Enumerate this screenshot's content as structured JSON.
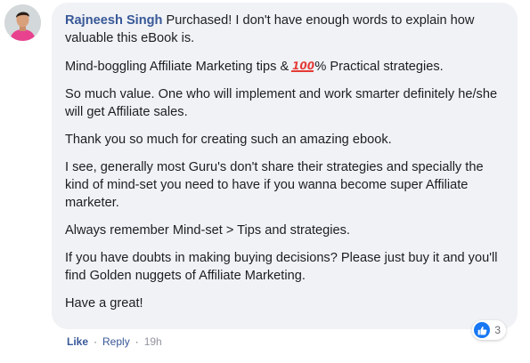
{
  "comment": {
    "author": "Rajneesh Singh",
    "paragraphs": [
      {
        "text": "Purchased! I don't have enough words to explain how valuable this eBook is."
      },
      {
        "before": "Mind-boggling Affiliate Marketing tips & ",
        "emoji": "100",
        "after": "% Practical strategies."
      },
      {
        "text": "So much value. One who will implement and work smarter definitely he/she will get Affiliate sales."
      },
      {
        "text": "Thank you so much for creating such an amazing ebook."
      },
      {
        "text": "I see, generally most Guru's don't share their strategies and specially the kind of mind-set you need to have if you wanna become super Affiliate marketer."
      },
      {
        "text": "Always remember Mind-set > Tips and strategies."
      },
      {
        "text": "If you have doubts in making buying decisions? Please just buy it and you'll find Golden nuggets of Affiliate Marketing."
      },
      {
        "text": "Have a great!"
      }
    ],
    "reactions": {
      "icon": "like-thumbs-up-icon",
      "count": "3",
      "color": "#1877f2"
    }
  },
  "footer": {
    "like_label": "Like",
    "separator": "·",
    "reply_label": "Reply",
    "time": "19h"
  },
  "colors": {
    "bubble_background": "#f0f2f5",
    "author_link": "#385898",
    "text": "#1c1e21",
    "meta": "#65676b",
    "emoji_red": "#e53935"
  }
}
